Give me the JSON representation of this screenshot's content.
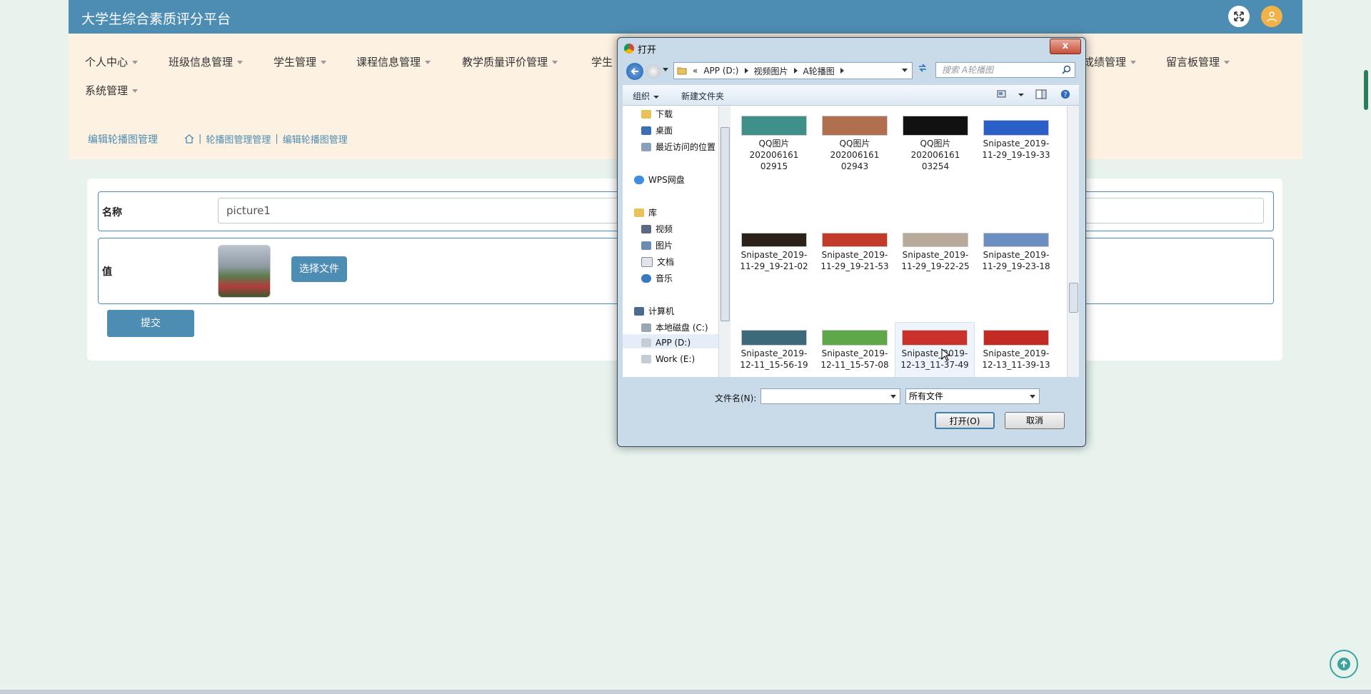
{
  "app": {
    "title": "大学生综合素质评分平台"
  },
  "nav": {
    "items": [
      "个人中心",
      "班级信息管理",
      "学生管理",
      "课程信息管理",
      "教学质量评价管理",
      "学生",
      "成绩管理",
      "留言板管理",
      "系统管理"
    ]
  },
  "breadcrumb": {
    "title": "编辑轮播图管理",
    "path1": "轮播图管理管理",
    "path2": "编辑轮播图管理",
    "sep": "|"
  },
  "form": {
    "name_label": "名称",
    "name_value": "picture1",
    "value_label": "值",
    "choose_file": "选择文件",
    "submit": "提交"
  },
  "dialog": {
    "title": "打开",
    "close": "x",
    "address": {
      "chevrons": "«",
      "segments": [
        "APP (D:)",
        "视频图片",
        "A轮播图"
      ]
    },
    "search_placeholder": "搜索 A轮播图",
    "toolbar": {
      "organize": "组织",
      "new_folder": "新建文件夹"
    },
    "tree": [
      {
        "label": "下载",
        "icon": "folder-download-icon"
      },
      {
        "label": "桌面",
        "icon": "desktop-icon"
      },
      {
        "label": "最近访问的位置",
        "icon": "recent-icon"
      },
      {
        "label": "WPS网盘",
        "icon": "cloud-icon"
      },
      {
        "label": "库",
        "icon": "library-icon"
      },
      {
        "label": "视频",
        "icon": "video-icon"
      },
      {
        "label": "图片",
        "icon": "picture-icon"
      },
      {
        "label": "文档",
        "icon": "document-icon"
      },
      {
        "label": "音乐",
        "icon": "music-icon"
      },
      {
        "label": "计算机",
        "icon": "computer-icon"
      },
      {
        "label": "本地磁盘 (C:)",
        "icon": "drive-icon"
      },
      {
        "label": "APP (D:)",
        "icon": "drive-icon"
      },
      {
        "label": "Work (E:)",
        "icon": "drive-icon"
      }
    ],
    "files": [
      {
        "l1": "QQ图片",
        "l2": "20200616102915",
        "color": "#3f8f8a"
      },
      {
        "l1": "QQ图片",
        "l2": "20200616102943",
        "color": "#b07050"
      },
      {
        "l1": "QQ图片",
        "l2": "20200616103254",
        "color": "#111111"
      },
      {
        "l1": "Snipaste_2019-",
        "l2": "11-29_19-19-33",
        "color": "#2a5fc8"
      },
      {
        "l1": "Snipaste_2019-",
        "l2": "11-29_19-21-02",
        "color": "#2a2218"
      },
      {
        "l1": "Snipaste_2019-",
        "l2": "11-29_19-21-53",
        "color": "#c43a2a"
      },
      {
        "l1": "Snipaste_2019-",
        "l2": "11-29_19-22-25",
        "color": "#b8a99a"
      },
      {
        "l1": "Snipaste_2019-",
        "l2": "11-29_19-23-18",
        "color": "#6a8fc0"
      },
      {
        "l1": "Snipaste_2019-",
        "l2": "12-11_15-56-19",
        "color": "#3d6a7a"
      },
      {
        "l1": "Snipaste_2019-",
        "l2": "12-11_15-57-08",
        "color": "#5ea84a"
      },
      {
        "l1": "Snipaste_2019-",
        "l2": "12-13_11-37-49",
        "color": "#c8322a"
      },
      {
        "l1": "Snipaste_2019-",
        "l2": "12-13_11-39-13",
        "color": "#c22b24"
      }
    ],
    "filename_label": "文件名(N):",
    "filetype": "所有文件",
    "open": "打开(O)",
    "cancel": "取消"
  }
}
